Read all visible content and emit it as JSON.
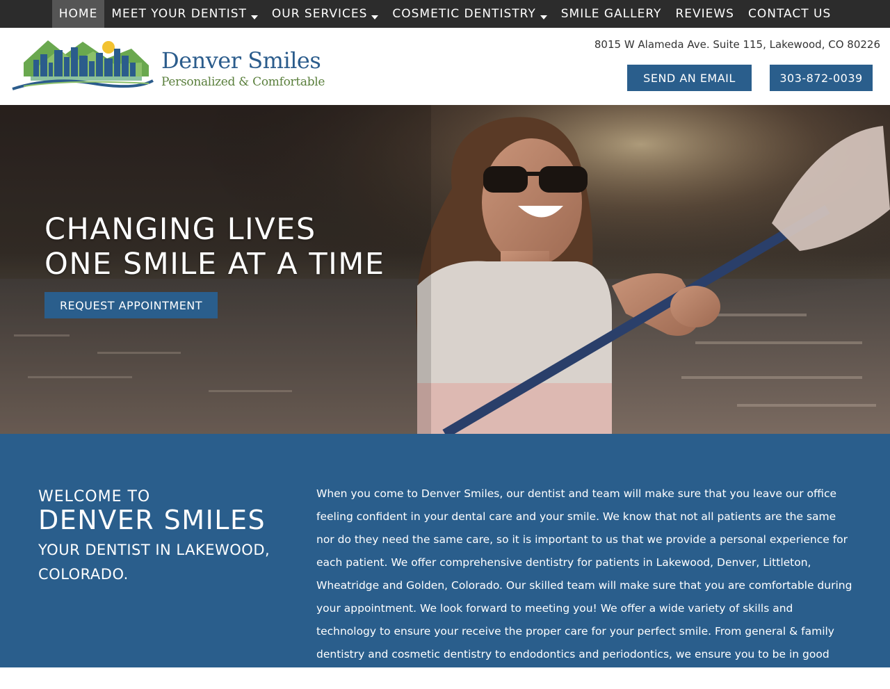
{
  "nav": {
    "items": [
      {
        "label": "HOME",
        "active": true,
        "dropdown": false
      },
      {
        "label": "MEET YOUR DENTIST",
        "active": false,
        "dropdown": true
      },
      {
        "label": "OUR SERVICES",
        "active": false,
        "dropdown": true
      },
      {
        "label": "COSMETIC DENTISTRY",
        "active": false,
        "dropdown": true
      },
      {
        "label": "SMILE GALLERY",
        "active": false,
        "dropdown": false
      },
      {
        "label": "REVIEWS",
        "active": false,
        "dropdown": false
      },
      {
        "label": "CONTACT US",
        "active": false,
        "dropdown": false
      }
    ]
  },
  "header": {
    "logo_name": "Denver Smiles",
    "logo_tagline": "Personalized & Comfortable",
    "address": "8015 W Alameda Ave. Suite 115, Lakewood, CO 80226",
    "email_button": "SEND AN EMAIL",
    "phone_button": "303-872-0039"
  },
  "hero": {
    "title_line1": "CHANGING LIVES",
    "title_line2": "ONE SMILE AT A TIME",
    "cta_button": "REQUEST APPOINTMENT"
  },
  "welcome": {
    "pre_title": "WELCOME TO",
    "title": "DENVER SMILES",
    "subtitle": "YOUR DENTIST IN LAKEWOOD, COLORADO.",
    "body": "When you come to Denver Smiles, our dentist and team will make sure that you leave our office feeling confident in your dental care and your smile. We know that not all patients are the same nor do they need the same care, so it is important to us that we provide a personal experience for each patient. We offer comprehensive dentistry for patients in Lakewood, Denver, Littleton, Wheatridge and Golden, Colorado. Our skilled team will make sure that you are comfortable during your appointment. We look forward to meeting you! We offer a wide variety of skills and technology to ensure your receive the proper care for your perfect smile. From general & family dentistry and cosmetic dentistry to endodontics and periodontics, we ensure you to be in good hands."
  },
  "colors": {
    "nav_bg": "#2c2c2c",
    "nav_active": "#555555",
    "brand_blue": "#2a5e8c",
    "logo_green": "#5a7f3c"
  }
}
